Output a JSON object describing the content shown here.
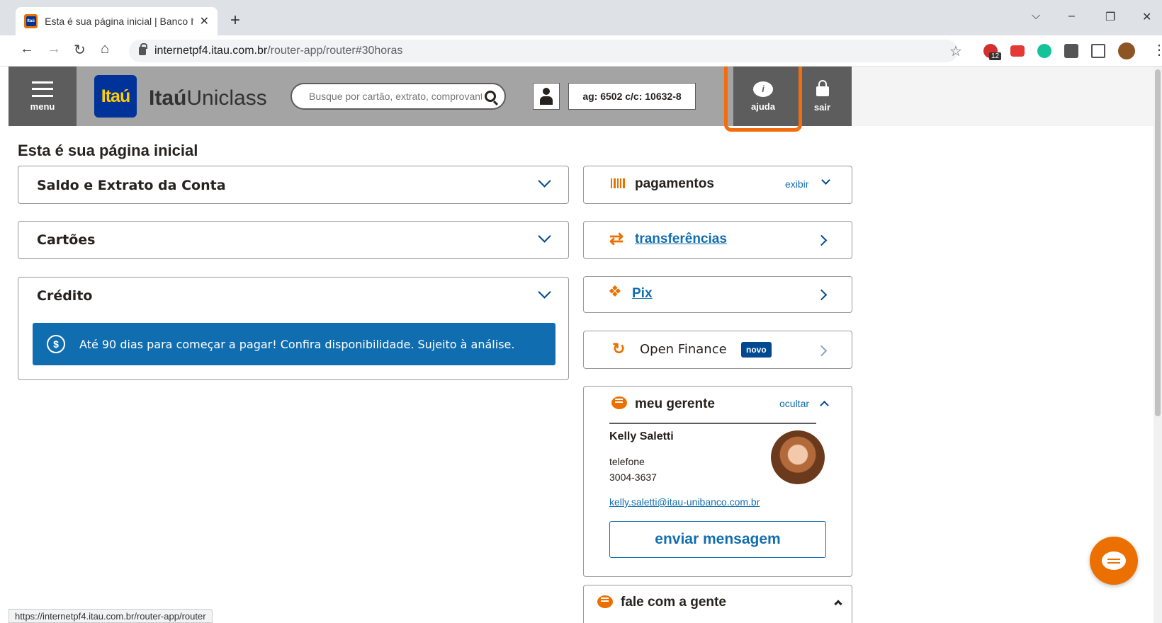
{
  "browser": {
    "tab_title": "Esta é sua página inicial | Banco Itaú",
    "favicon_text": "Itaú",
    "new_tab": "+",
    "url_host": "internetpf4.itau.com.br",
    "url_path": "/router-app/router#30horas",
    "status_url": "https://internetpf4.itau.com.br/router-app/router",
    "tab_close": "✕",
    "win_dropdown": "⌵",
    "win_minimize": "–",
    "win_restore": "❐",
    "win_close": "✕",
    "star": "☆",
    "extensions_badge": "12"
  },
  "header": {
    "menu_label": "menu",
    "logo_text": "Itaú",
    "brand_bold": "Itaú",
    "brand_light": "Uniclass",
    "search_placeholder": "Busque por cartão, extrato, comprovante",
    "account": "ag: 6502 c/c: 10632-8",
    "help_label": "ajuda",
    "help_icon_glyph": "i",
    "exit_label": "sair"
  },
  "page_title": "Esta é sua página inicial",
  "left_cards": {
    "balance": "Saldo e Extrato da Conta",
    "cards": "Cartões",
    "credit": "Crédito",
    "credit_banner": "Até 90 dias para começar a pagar! Confira disponibilidade. Sujeito à análise.",
    "dollar_glyph": "$"
  },
  "right_cards": {
    "payments": "pagamentos",
    "payments_toggle": "exibir",
    "transfers": "transferências",
    "transfers_glyph": "⇄",
    "pix": "Pix",
    "pix_glyph": "❖",
    "open_finance": "Open Finance",
    "open_finance_glyph": "↻",
    "open_finance_badge": "novo"
  },
  "manager": {
    "title": "meu gerente",
    "toggle": "ocultar",
    "name": "Kelly Saletti",
    "phone_label": "telefone",
    "phone": "3004-3637",
    "email": "kelly.saletti@itau-unibanco.com.br",
    "send_button": "enviar mensagem"
  },
  "contact": {
    "title": "fale com a gente"
  },
  "colors": {
    "itau_orange": "#ec7000",
    "itau_blue": "#003399",
    "link_blue": "#106eb0",
    "header_gray": "#a4a4a4",
    "dark_gray": "#5d5d5d",
    "highlight": "#f56c0c"
  },
  "icons": [
    "hamburger-icon",
    "search-icon",
    "user-icon",
    "help-chat-icon",
    "lock-icon",
    "barcode-icon",
    "transfer-arrows-icon",
    "pix-icon",
    "open-finance-icon",
    "chat-bubble-icon",
    "dollar-circle-icon",
    "chevron-down-icon",
    "chevron-right-icon",
    "chevron-up-icon"
  ]
}
